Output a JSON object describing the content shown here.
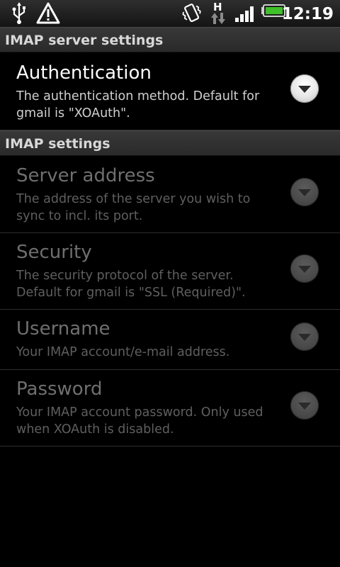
{
  "status_bar": {
    "time": "12:19",
    "network_type": "H",
    "icons": [
      "usb-icon",
      "warning-icon",
      "vibrate-icon",
      "network-type-icon",
      "signal-icon",
      "battery-icon"
    ],
    "battery_color": "#3fbf2a"
  },
  "sections": [
    {
      "header": "IMAP server settings",
      "items": [
        {
          "title": "Authentication",
          "summary": "The authentication method. Default for gmail is \"XOAuth\".",
          "enabled": true
        }
      ]
    },
    {
      "header": "IMAP settings",
      "items": [
        {
          "title": "Server address",
          "summary": "The address of the server you wish to sync to incl. its port.",
          "enabled": false
        },
        {
          "title": "Security",
          "summary": "The security protocol of the server. Default for gmail is \"SSL (Required)\".",
          "enabled": false
        },
        {
          "title": "Username",
          "summary": "Your IMAP account/e-mail address.",
          "enabled": false
        },
        {
          "title": "Password",
          "summary": "Your IMAP account password. Only used when XOAuth is disabled.",
          "enabled": false
        }
      ]
    }
  ],
  "colors": {
    "background": "#000000",
    "header_bg": "#333333",
    "enabled_text": "#ffffff",
    "disabled_text": "#6f6f6f"
  }
}
